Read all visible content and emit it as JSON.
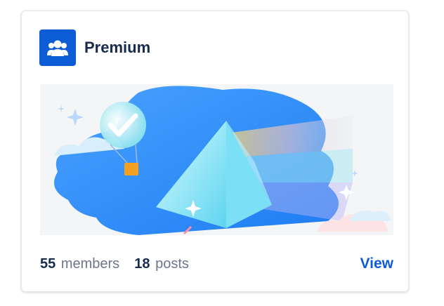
{
  "card": {
    "title": "Premium",
    "icon": "group-icon",
    "members_count": "55",
    "members_label": "members",
    "posts_count": "18",
    "posts_label": "posts",
    "view_label": "View"
  },
  "colors": {
    "accent": "#0b5cd5",
    "title": "#172b4d",
    "muted": "#6b778c"
  }
}
